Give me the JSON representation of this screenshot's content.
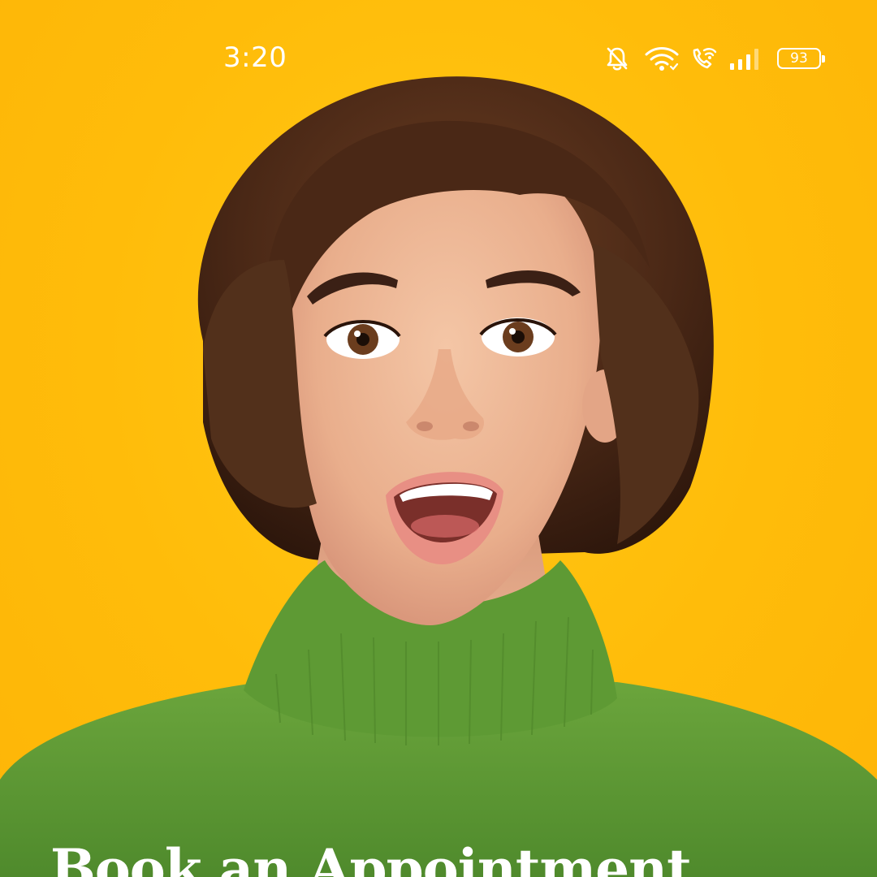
{
  "status_bar": {
    "time": "3:20",
    "battery_level": "93",
    "icons": [
      "bell-off-icon",
      "wifi-icon",
      "wifi-calling-icon",
      "signal-icon",
      "battery-icon"
    ]
  },
  "hero": {
    "background_color": "#FFC20E",
    "sweater_color": "#5E9A34",
    "hair_color": "#4A2A18"
  },
  "headline": {
    "text": "Book an Appointment"
  }
}
